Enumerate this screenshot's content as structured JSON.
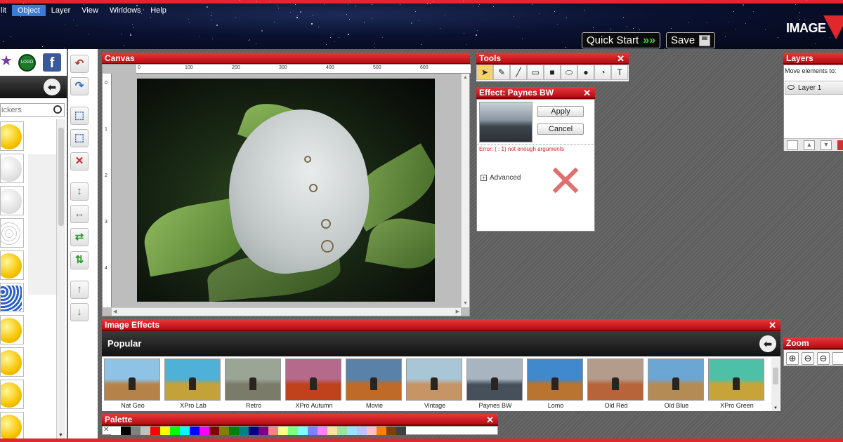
{
  "menu": {
    "items": [
      "lit",
      "Object",
      "Layer",
      "View",
      "Windows",
      "·",
      "Help"
    ]
  },
  "topbar": {
    "quick_start": "Quick Start",
    "quick_start_arrows": "»»",
    "save": "Save",
    "logo": "IMAGE"
  },
  "left_panel": {
    "search_placeholder": "ickers",
    "logo_icon": "LOGO"
  },
  "canvas": {
    "title": "Canvas",
    "ruler_top": [
      "0",
      "100",
      "200",
      "300",
      "400",
      "500",
      "600"
    ],
    "ruler_left": [
      "0",
      "1",
      "2",
      "3",
      "4"
    ]
  },
  "tools": {
    "title": "Tools",
    "close": "✕",
    "items": [
      "pointer-icon",
      "pencil-icon",
      "line-icon",
      "rectangle-icon",
      "filled-rectangle-icon",
      "ellipse-icon",
      "circle-icon",
      "shape-icon",
      "text-icon"
    ]
  },
  "effect": {
    "title": "Effect: Paynes BW",
    "close": "✕",
    "apply": "Apply",
    "cancel": "Cancel",
    "error": "Error: ( : 1) not enough arguments",
    "advanced": "Advanced",
    "advanced_toggle": "+"
  },
  "layers": {
    "title": "Layers",
    "move_text": "Move elements to:",
    "layer_name": "Layer 1"
  },
  "image_effects": {
    "title": "Image Effects",
    "close": "✕",
    "section": "Popular",
    "items": [
      {
        "label": "Nat Geo",
        "sky": "#8ec3e6",
        "ground": "#b5834a"
      },
      {
        "label": "XPro Lab",
        "sky": "#4fb0d8",
        "ground": "#c4a23a"
      },
      {
        "label": "Retro",
        "sky": "#9aa596",
        "ground": "#7b7b6a"
      },
      {
        "label": "XPro Autumn",
        "sky": "#b56a8c",
        "ground": "#c0421c"
      },
      {
        "label": "Movie",
        "sky": "#5a82a8",
        "ground": "#c06a28"
      },
      {
        "label": "Vintage",
        "sky": "#a8c6d6",
        "ground": "#c79466"
      },
      {
        "label": "Paynes BW",
        "sky": "#a8b4c0",
        "ground": "#45505a"
      },
      {
        "label": "Lomo",
        "sky": "#3f89cc",
        "ground": "#b87430"
      },
      {
        "label": "Old Red",
        "sky": "#b39c8c",
        "ground": "#b8643a"
      },
      {
        "label": "Old Blue",
        "sky": "#6ca6d4",
        "ground": "#b48a55"
      },
      {
        "label": "XPro Green",
        "sky": "#4fc0a8",
        "ground": "#c6a43a"
      }
    ]
  },
  "palette": {
    "title": "Palette",
    "close": "✕",
    "colors": [
      "#ffffff",
      "#000000",
      "#808080",
      "#c0c0c0",
      "#ff0000",
      "#ffff00",
      "#00ff00",
      "#00ffff",
      "#0000ff",
      "#ff00ff",
      "#800000",
      "#808000",
      "#008000",
      "#008080",
      "#000080",
      "#800080",
      "#ff8080",
      "#ffff80",
      "#80ff80",
      "#80ffff",
      "#8080ff",
      "#ff80ff",
      "#ffe0a0",
      "#a0e0a0",
      "#a0e0ff",
      "#c0c0ff",
      "#ffc0c0",
      "#ff8000",
      "#804000",
      "#404040"
    ]
  },
  "zoom": {
    "title": "Zoom",
    "icons": [
      "zoom-in-icon",
      "zoom-out-icon",
      "zoom-fit-icon"
    ]
  }
}
